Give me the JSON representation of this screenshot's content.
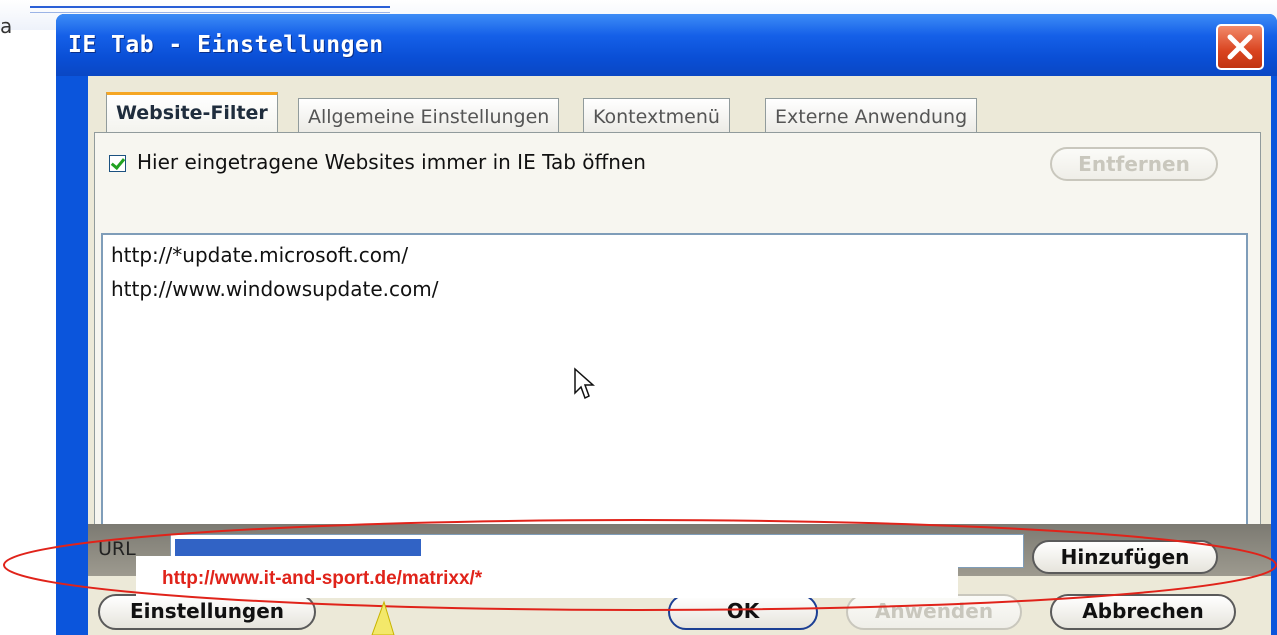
{
  "background": {
    "partial_letter": "a"
  },
  "dialog": {
    "title": "IE Tab - Einstellungen",
    "close_icon": "close-icon"
  },
  "tabs": [
    {
      "label": "Website-Filter",
      "active": true
    },
    {
      "label": "Allgemeine Einstellungen",
      "active": false
    },
    {
      "label": "Kontextmenü",
      "active": false
    },
    {
      "label": "Externe Anwendung",
      "active": false
    }
  ],
  "filter": {
    "checkbox_label": "Hier eingetragene Websites immer in IE Tab öffnen",
    "checkbox_checked": true,
    "remove_label": "Entfernen",
    "urls": [
      "http://*update.microsoft.com/",
      "http://www.windowsupdate.com/"
    ]
  },
  "url_row": {
    "label": "URL",
    "add_label": "Hinzufügen"
  },
  "overlay": {
    "text": "http://www.it-and-sport.de/matrixx/*",
    "color": "#e0231a"
  },
  "buttons": {
    "settings_label": "Einstellungen",
    "ok_label": "OK",
    "apply_label": "Anwenden",
    "cancel_label": "Abbrechen"
  },
  "colors": {
    "titlebar": "#1560e8",
    "close_button": "#d9431f",
    "tab_accent": "#f5a623",
    "annotation_ellipse": "#e0231a"
  }
}
